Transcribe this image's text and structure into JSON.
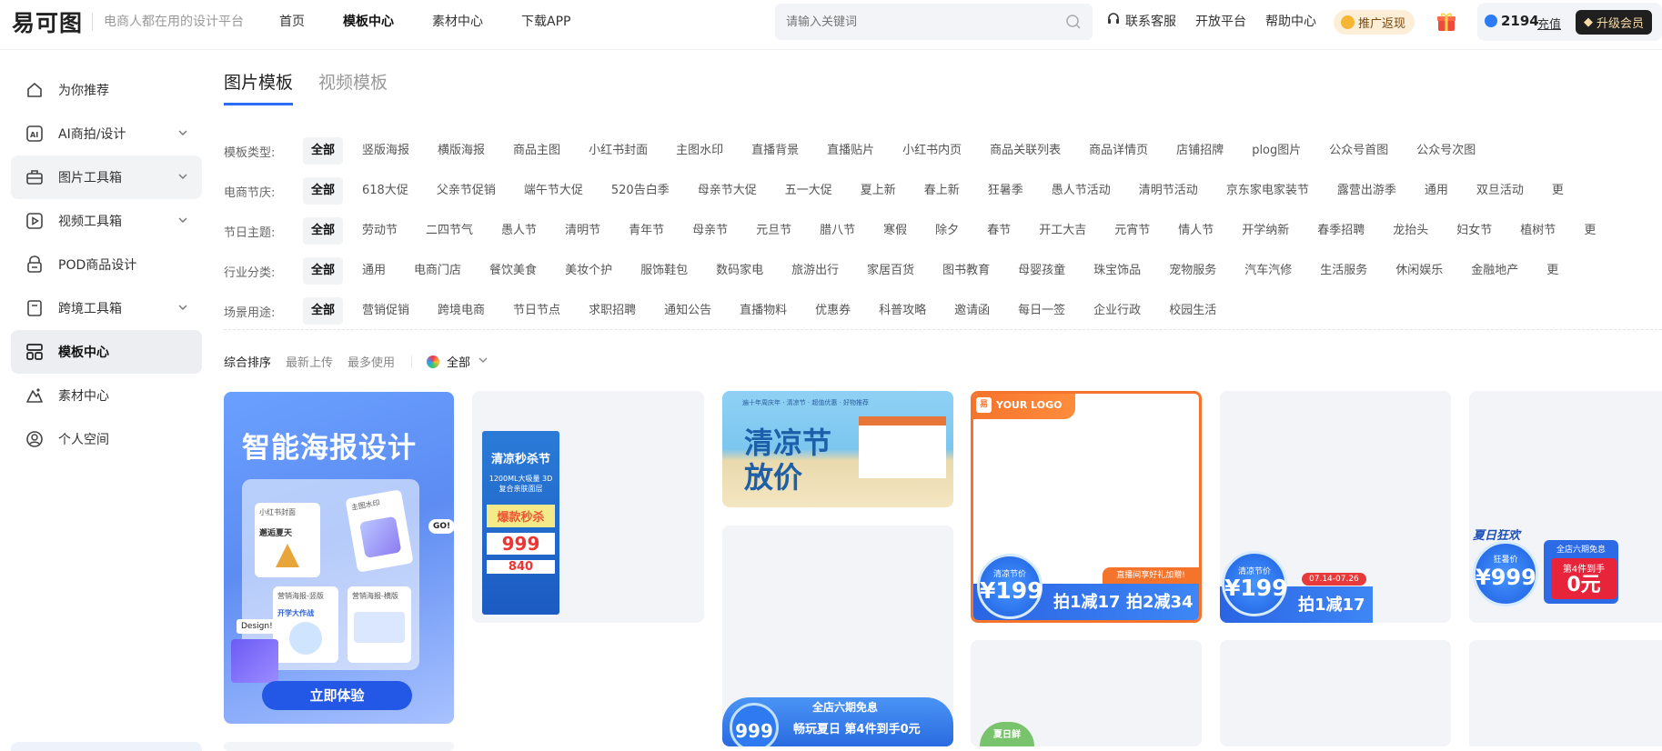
{
  "header": {
    "logo": "易可图",
    "slogan": "电商人都在用的设计平台",
    "nav": [
      "首页",
      "模板中心",
      "素材中心",
      "下载APP"
    ],
    "search_placeholder": "请输入关键词",
    "links": [
      "联系客服",
      "开放平台",
      "帮助中心"
    ],
    "promo": "推广返现",
    "credits": "2194",
    "recharge": "充值",
    "vip": "升级会员"
  },
  "sidebar": {
    "items": [
      {
        "label": "为你推荐",
        "icon": "home-icon",
        "chevron": false
      },
      {
        "label": "AI商拍/设计",
        "icon": "ai-icon",
        "chevron": true
      },
      {
        "label": "图片工具箱",
        "icon": "toolbox-icon",
        "chevron": true
      },
      {
        "label": "视频工具箱",
        "icon": "video-icon",
        "chevron": true
      },
      {
        "label": "POD商品设计",
        "icon": "pod-icon",
        "chevron": false
      },
      {
        "label": "跨境工具箱",
        "icon": "crossborder-icon",
        "chevron": true
      },
      {
        "label": "模板中心",
        "icon": "template-icon",
        "chevron": false
      },
      {
        "label": "素材中心",
        "icon": "material-icon",
        "chevron": false
      },
      {
        "label": "个人空间",
        "icon": "user-icon",
        "chevron": false
      }
    ]
  },
  "tabs": [
    "图片模板",
    "视频模板"
  ],
  "filters": [
    {
      "label": "模板类型:",
      "options": [
        "全部",
        "竖版海报",
        "横版海报",
        "商品主图",
        "小红书封面",
        "主图水印",
        "直播背景",
        "直播贴片",
        "小红书内页",
        "商品关联列表",
        "商品详情页",
        "店铺招牌",
        "plog图片",
        "公众号首图",
        "公众号次图"
      ]
    },
    {
      "label": "电商节庆:",
      "options": [
        "全部",
        "618大促",
        "父亲节促销",
        "端午节大促",
        "520告白季",
        "母亲节大促",
        "五一大促",
        "夏上新",
        "春上新",
        "狂暑季",
        "愚人节活动",
        "清明节活动",
        "京东家电家装节",
        "露营出游季",
        "通用",
        "双旦活动",
        "更"
      ]
    },
    {
      "label": "节日主题:",
      "options": [
        "全部",
        "劳动节",
        "二四节气",
        "愚人节",
        "清明节",
        "青年节",
        "母亲节",
        "元旦节",
        "腊八节",
        "寒假",
        "除夕",
        "春节",
        "开工大吉",
        "元宵节",
        "情人节",
        "开学纳新",
        "春季招聘",
        "龙抬头",
        "妇女节",
        "植树节",
        "更"
      ]
    },
    {
      "label": "行业分类:",
      "options": [
        "全部",
        "通用",
        "电商门店",
        "餐饮美食",
        "美妆个护",
        "服饰鞋包",
        "数码家电",
        "旅游出行",
        "家居百货",
        "图书教育",
        "母婴孩童",
        "珠宝饰品",
        "宠物服务",
        "汽车汽修",
        "生活服务",
        "休闲娱乐",
        "金融地产",
        "更"
      ]
    },
    {
      "label": "场景用途:",
      "options": [
        "全部",
        "营销促销",
        "跨境电商",
        "节日节点",
        "求职招聘",
        "通知公告",
        "直播物料",
        "优惠券",
        "科普攻略",
        "邀请函",
        "每日一签",
        "企业行政",
        "校园生活"
      ]
    }
  ],
  "sort": {
    "options": [
      "综合排序",
      "最新上传",
      "最多使用"
    ],
    "color_filter": "全部"
  },
  "cards": {
    "poster_ai": {
      "title": "智能海报设计",
      "cta": "立即体验",
      "mini1": "小红书封面",
      "mini1_text": "邂逅夏天",
      "mini2": "主图水印",
      "mini3": "营销海报-竖版",
      "mini3_text": "开学大作战",
      "mini4": "营销海报-横版",
      "design_tag": "Design!",
      "go_tag": "GO!"
    },
    "cool_sale": {
      "title": "清凉秒杀节",
      "sub": "1200ML大吸量 3D复合亲肤面层",
      "tag": "爆款秒杀",
      "price1": "999",
      "price2": "840"
    },
    "cool_festival": {
      "title": "清凉节 放价",
      "top": "遍十年周庆年 · 清凉节 · 超值优惠 · 好物推荐"
    },
    "six_free": {
      "circle": "999",
      "title": "全店六期免息",
      "sub": "畅玩夏日 第4件到手0元"
    },
    "logo_card": {
      "logo": "YOUR LOGO",
      "circle_small": "清凉节价",
      "price": "¥199",
      "live": "直播间享好礼加赠!",
      "deal1": "拍1减17",
      "deal2": "拍2减34"
    },
    "date_card": {
      "circle_small": "清凉节价",
      "price": "¥199",
      "date": "07.14-07.26",
      "deal1": "拍1减17"
    },
    "summer_card": {
      "title": "夏日狂欢",
      "circle_small": "狂暑价",
      "price": "¥999",
      "tag": "全店六期免息",
      "red1": "第4件到手",
      "red2": "0元"
    },
    "bottom_card": {
      "title": "夏日鲜"
    }
  }
}
